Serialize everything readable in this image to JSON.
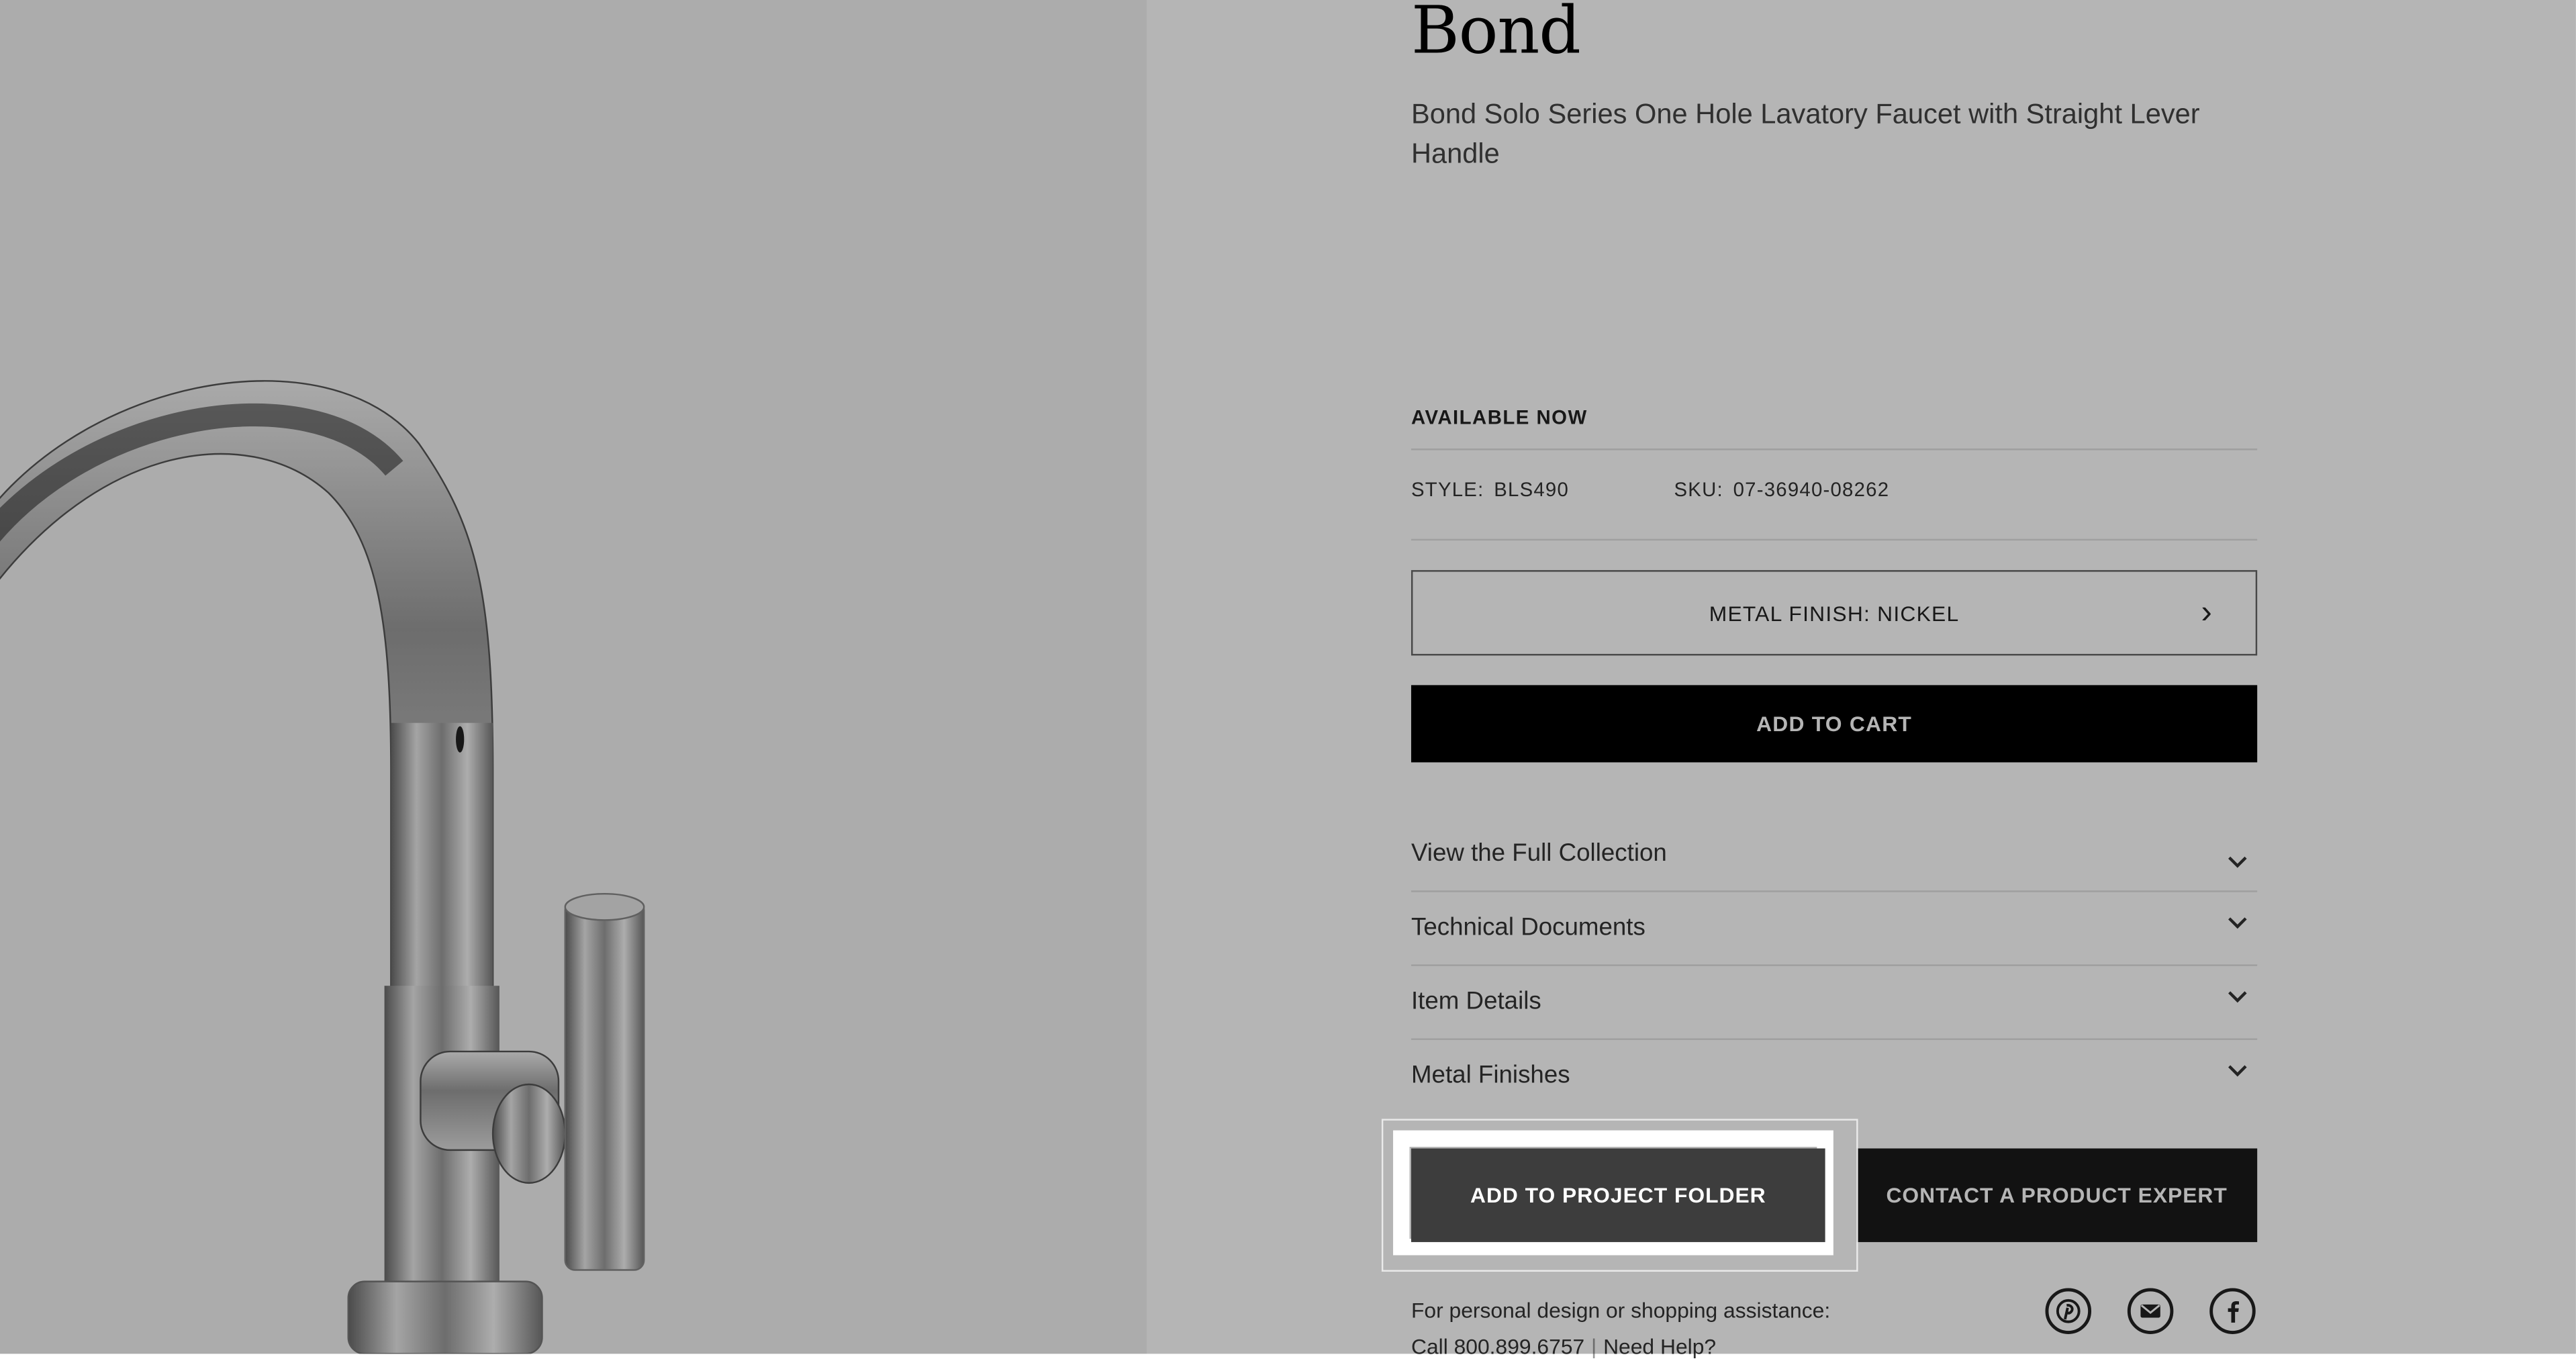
{
  "product": {
    "collection": "Bond",
    "description": "Bond Solo Series One Hole Lavatory Faucet with Straight Lever Handle",
    "availability": "AVAILABLE NOW",
    "style_label": "STYLE:",
    "style_value": "BLS490",
    "sku_label": "SKU:",
    "sku_value": "07-36940-08262"
  },
  "finish_select": {
    "label": "METAL FINISH: NICKEL"
  },
  "buttons": {
    "add_to_cart": "ADD TO CART",
    "add_to_project_folder": "ADD TO PROJECT FOLDER",
    "contact_expert": "CONTACT A PRODUCT EXPERT"
  },
  "accordion": [
    {
      "label": "View the Full Collection"
    },
    {
      "label": "Technical Documents"
    },
    {
      "label": "Item Details"
    },
    {
      "label": "Metal Finishes"
    }
  ],
  "assistance": {
    "text": "For personal design or shopping assistance:",
    "call": "Call 800.899.6757",
    "separator": "|",
    "help_link": "Need Help?"
  },
  "social_icons": [
    "pinterest-icon",
    "email-icon",
    "facebook-icon"
  ],
  "colors": {
    "overlay": "rgba(0,0,0,0.29)",
    "primary_button": "#000000",
    "highlight": "#ffffff"
  }
}
